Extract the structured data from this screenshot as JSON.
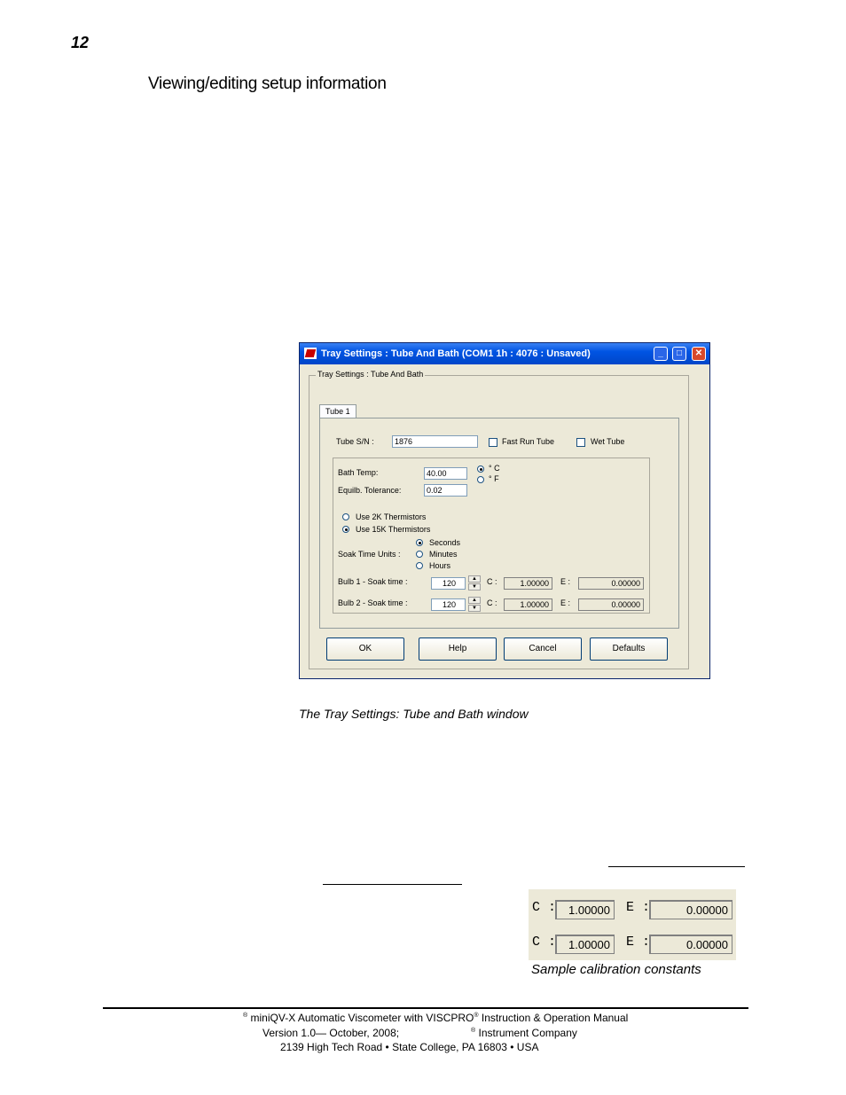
{
  "page_number": "12",
  "section_title": "Viewing/editing setup information",
  "dialog": {
    "title": "Tray Settings : Tube And Bath (COM1 1h : 4076 : Unsaved)",
    "minimize": "_",
    "maximize": "□",
    "close": "✕",
    "group_label": "Tray Settings : Tube And Bath",
    "tab_label": "Tube 1",
    "tube_sn_label": "Tube S/N :",
    "tube_sn_value": "1876",
    "fast_run_label": "Fast Run Tube",
    "wet_tube_label": "Wet Tube",
    "bath_temp_label": "Bath Temp:",
    "bath_temp_value": "40.00",
    "equilb_tol_label": "Equilb. Tolerance:",
    "equilb_tol_value": "0.02",
    "unit_c_label": "° C",
    "unit_f_label": "° F",
    "therm_2k_label": "Use 2K Thermistors",
    "therm_15k_label": "Use 15K Thermistors",
    "soak_units_label": "Soak Time Units :",
    "unit_seconds": "Seconds",
    "unit_minutes": "Minutes",
    "unit_hours": "Hours",
    "bulb1_label": "Bulb 1 - Soak time :",
    "bulb1_value": "120",
    "bulb2_label": "Bulb 2 - Soak time :",
    "bulb2_value": "120",
    "c_label": "C :",
    "e_label": "E :",
    "bulb1_c": "1.00000",
    "bulb1_e": "0.00000",
    "bulb2_c": "1.00000",
    "bulb2_e": "0.00000",
    "spin_up": "▲",
    "spin_down": "▼",
    "btn_ok": "OK",
    "btn_help": "Help",
    "btn_cancel": "Cancel",
    "btn_defaults": "Defaults"
  },
  "dialog_caption": "The Tray Settings: Tube and Bath window",
  "calibration": {
    "c_label": "C :",
    "e_label": "E :",
    "row1_c": "1.00000",
    "row1_e": "0.00000",
    "row2_c": "1.00000",
    "row2_e": "0.00000",
    "caption": "Sample calibration constants"
  },
  "footer": {
    "reg": "®",
    "line1_a": "miniQV-X Automatic Viscometer with VISCPRO",
    "line1_b": "Instruction & Operation Manual",
    "line2_a": "Version 1.0— October, 2008;",
    "line2_b": "Instrument Company",
    "line3": "2139 High Tech Road • State College, PA  16803 • USA"
  }
}
